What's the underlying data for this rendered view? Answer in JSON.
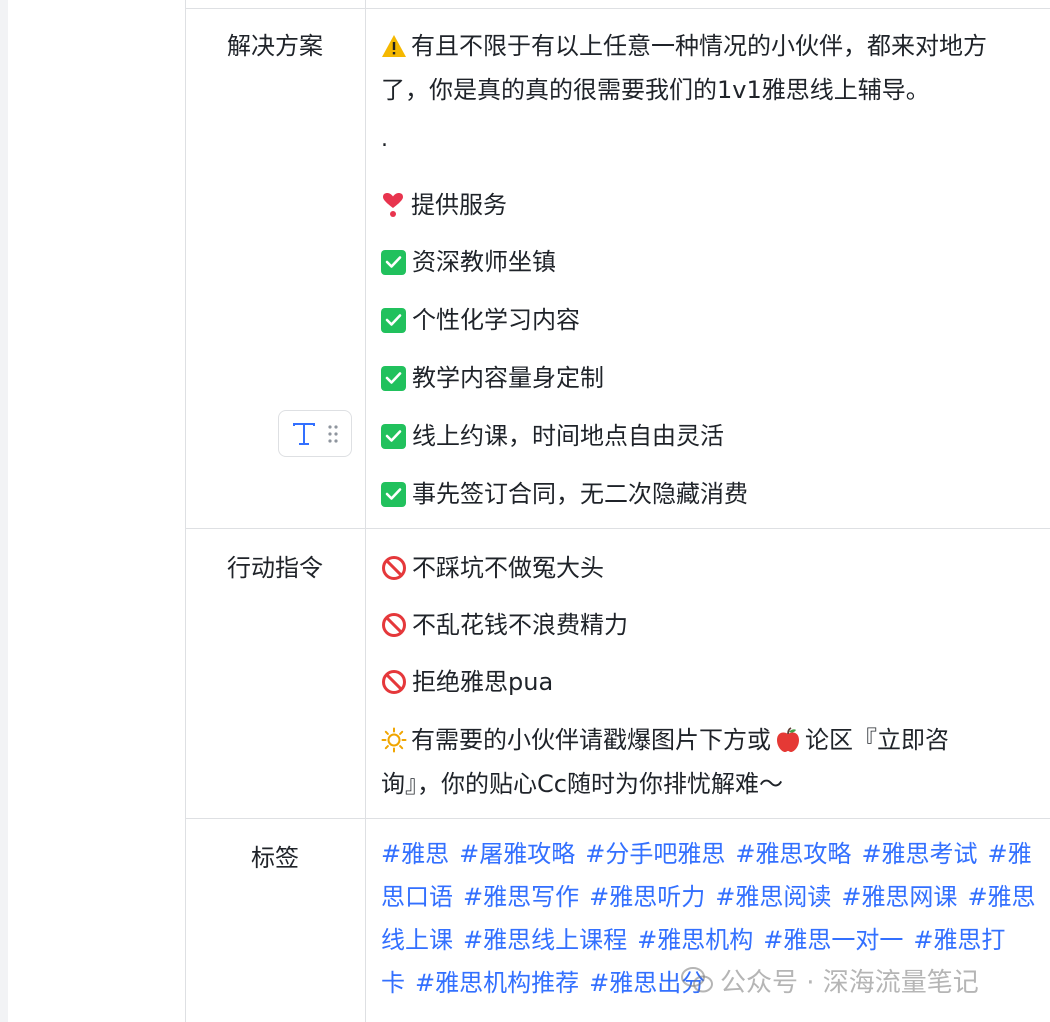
{
  "rows": [
    {
      "label": "解决方案",
      "intro_1": "有且不限于有以上任意一种情况的小伙伴，都来对地方",
      "intro_2": "了，你是真的真的很需要我们的1v1雅思线上辅导。",
      "dot": ".",
      "services_title": "提供服务",
      "services": [
        "资深教师坐镇",
        "个性化学习内容",
        "教学内容量身定制",
        "线上约课，时间地点自由灵活",
        "事先签订合同，无二次隐藏消费"
      ]
    },
    {
      "label": "行动指令",
      "actions": [
        "不踩坑不做冤大头",
        "不乱花钱不浪费精力",
        "拒绝雅思pua"
      ],
      "cta_a": "有需要的小伙伴请戳爆图片下方或",
      "cta_b": "论区『立即咨",
      "cta_c": "询』，你的贴心Cc随时为你排忧解难～"
    },
    {
      "label": "标签",
      "tags": [
        "#雅思",
        "#屠雅攻略",
        "#分手吧雅思",
        "#雅思攻略",
        "#雅思考试",
        "#雅思口语",
        "#雅思写作",
        "#雅思听力",
        "#雅思阅读",
        "#雅思网课",
        "#雅思线上课",
        "#雅思线上课程",
        "#雅思机构",
        "#雅思一对一",
        "#雅思打卡",
        "#雅思机构推荐",
        "#雅思出分"
      ]
    }
  ],
  "icons": {
    "warning": "warning-icon",
    "heart": "heart-exclamation-icon",
    "check": "check-box-icon",
    "ban": "prohibited-icon",
    "sun": "sun-icon",
    "apple": "apple-icon",
    "text_tool": "text-format-icon",
    "drag": "drag-handle-icon"
  },
  "colors": {
    "tag": "#3370ff",
    "check": "#21c15d",
    "ban": "#e5383b",
    "border": "#dee0e3"
  },
  "toolbar": {
    "text_button": "T"
  },
  "watermark": "公众号 · 深海流量笔记"
}
